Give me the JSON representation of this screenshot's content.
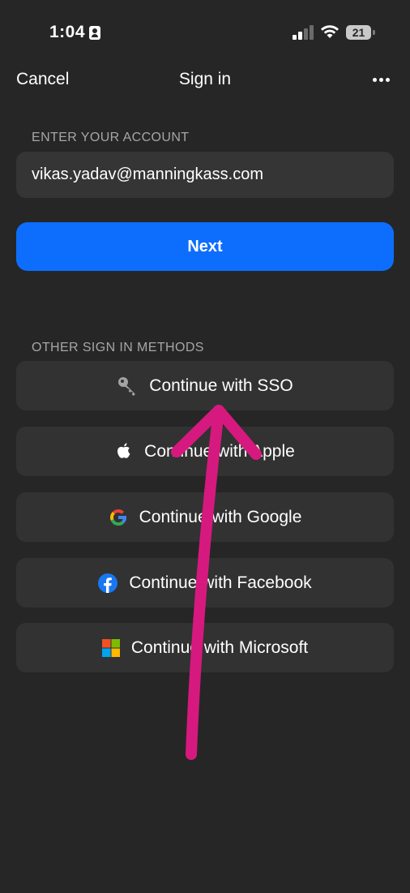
{
  "status_bar": {
    "time": "1:04",
    "battery": "21"
  },
  "nav": {
    "cancel": "Cancel",
    "title": "Sign in"
  },
  "account": {
    "section_label": "ENTER YOUR ACCOUNT",
    "email": "vikas.yadav@manningkass.com",
    "next_label": "Next"
  },
  "other_methods": {
    "section_label": "OTHER SIGN IN METHODS",
    "buttons": [
      {
        "label": "Continue with SSO",
        "icon": "key-icon"
      },
      {
        "label": "Continue with Apple",
        "icon": "apple-icon"
      },
      {
        "label": "Continue with Google",
        "icon": "google-icon"
      },
      {
        "label": "Continue with Facebook",
        "icon": "facebook-icon"
      },
      {
        "label": "Continue with Microsoft",
        "icon": "microsoft-icon"
      }
    ]
  },
  "colors": {
    "background": "#262626",
    "primary": "#0d6efd",
    "annotation": "#d6197f"
  }
}
